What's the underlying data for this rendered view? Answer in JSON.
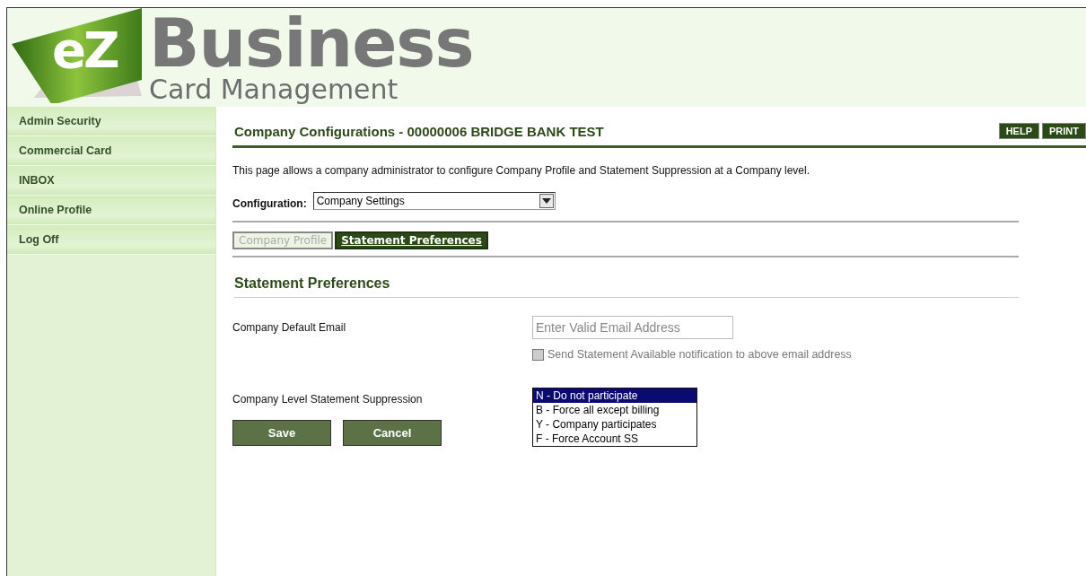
{
  "logo": {
    "mark": "eZ",
    "title": "Business",
    "subtitle": "Card Management"
  },
  "sidebar": {
    "items": [
      {
        "label": "Admin Security",
        "selected": false
      },
      {
        "label": "Commercial Card",
        "selected": false
      },
      {
        "label": "INBOX",
        "selected": false
      },
      {
        "label": "Online Profile",
        "selected": false
      },
      {
        "label": "Log Off",
        "selected": false
      }
    ]
  },
  "page": {
    "title": "Company Configurations - 00000006 BRIDGE BANK TEST",
    "actions": [
      "HELP",
      "PRINT"
    ],
    "description": "This page allows a company administrator to configure Company Profile and Statement Suppression at a Company level.",
    "configuration": {
      "label": "Configuration:",
      "value": "Company Settings"
    },
    "tabs": [
      {
        "label": "Company Profile",
        "selected": false
      },
      {
        "label": "Statement Preferences",
        "selected": true
      }
    ],
    "section_title": "Statement Preferences",
    "email": {
      "label": "Company Default Email",
      "placeholder": "Enter Valid Email Address"
    },
    "notify": {
      "label": "Send Statement Available notification to above email address",
      "checked": false,
      "disabled": true
    },
    "suppression": {
      "label": "Company Level Statement Suppression",
      "options": [
        {
          "label": "N - Do not participate",
          "selected": true
        },
        {
          "label": "B - Force all except billing",
          "selected": false
        },
        {
          "label": "Y - Company participates",
          "selected": false
        },
        {
          "label": "F - Force Account SS",
          "selected": false
        }
      ]
    },
    "buttons": [
      "Save",
      "Cancel"
    ]
  }
}
